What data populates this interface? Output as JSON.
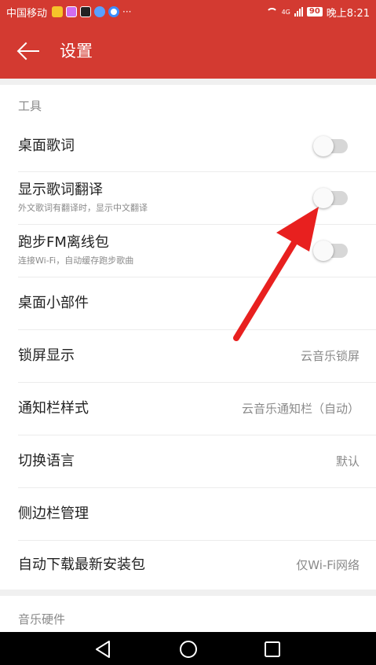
{
  "status_bar": {
    "carrier": "中国移动",
    "network": "4G",
    "battery": "90",
    "time": "晚上8:21"
  },
  "header": {
    "back_icon": "arrow-left-icon",
    "title": "设置"
  },
  "sections": {
    "tools": {
      "heading": "工具",
      "items": [
        {
          "label": "桌面歌词",
          "control": "toggle",
          "checked": false
        },
        {
          "label": "显示歌词翻译",
          "sublabel": "外文歌词有翻译时，显示中文翻译",
          "control": "toggle",
          "checked": false
        },
        {
          "label": "跑步FM离线包",
          "sublabel": "连接Wi-Fi，自动缓存跑步歌曲",
          "control": "toggle",
          "checked": false
        },
        {
          "label": "桌面小部件"
        },
        {
          "label": "锁屏显示",
          "value": "云音乐锁屏"
        },
        {
          "label": "通知栏样式",
          "value": "云音乐通知栏（自动）"
        },
        {
          "label": "切换语言",
          "value": "默认"
        },
        {
          "label": "侧边栏管理"
        },
        {
          "label": "自动下载最新安装包",
          "value": "仅Wi-Fi网络"
        }
      ]
    },
    "hardware": {
      "heading": "音乐硬件"
    }
  },
  "nav_bar": {
    "back": "triangle-back-icon",
    "home": "circle-home-icon",
    "recents": "square-recents-icon"
  },
  "colors": {
    "brand_red": "#d33a31",
    "annotation_arrow": "#e8201f",
    "toggle_track": "#d7d7d7"
  }
}
